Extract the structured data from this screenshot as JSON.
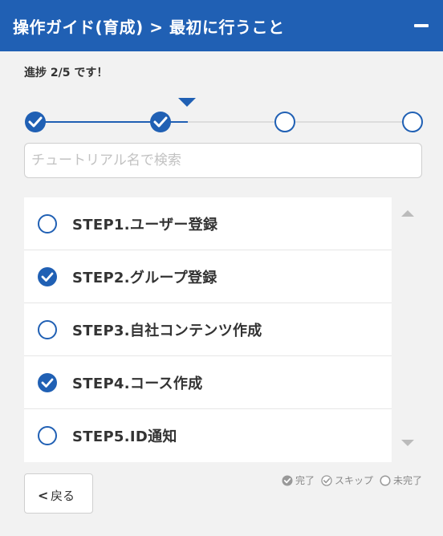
{
  "header": {
    "title": "操作ガイド(育成) > 最初に行うこと",
    "minimize_icon": "minimize-icon"
  },
  "progress": {
    "text": "進捗 2/5 です！",
    "completed": 2,
    "total": 5,
    "current_step": 2
  },
  "stepper": {
    "nodes": [
      {
        "state": "done"
      },
      {
        "state": "done"
      },
      {
        "state": "todo"
      },
      {
        "state": "todo"
      }
    ]
  },
  "search": {
    "placeholder": "チュートリアル名で検索",
    "value": ""
  },
  "steps": [
    {
      "label": "STEP1.ユーザー登録",
      "state": "incomplete"
    },
    {
      "label": "STEP2.グループ登録",
      "state": "complete"
    },
    {
      "label": "STEP3.自社コンテンツ作成",
      "state": "incomplete"
    },
    {
      "label": "STEP4.コース作成",
      "state": "complete"
    },
    {
      "label": "STEP5.ID通知",
      "state": "incomplete"
    }
  ],
  "back_button": {
    "label": "戻る",
    "icon": "chevron-left-icon"
  },
  "legend": {
    "complete": "完了",
    "skip": "スキップ",
    "incomplete": "未完了"
  },
  "colors": {
    "primary": "#2060b4",
    "line_inactive": "#dddddd",
    "background": "#f2f2f2"
  }
}
